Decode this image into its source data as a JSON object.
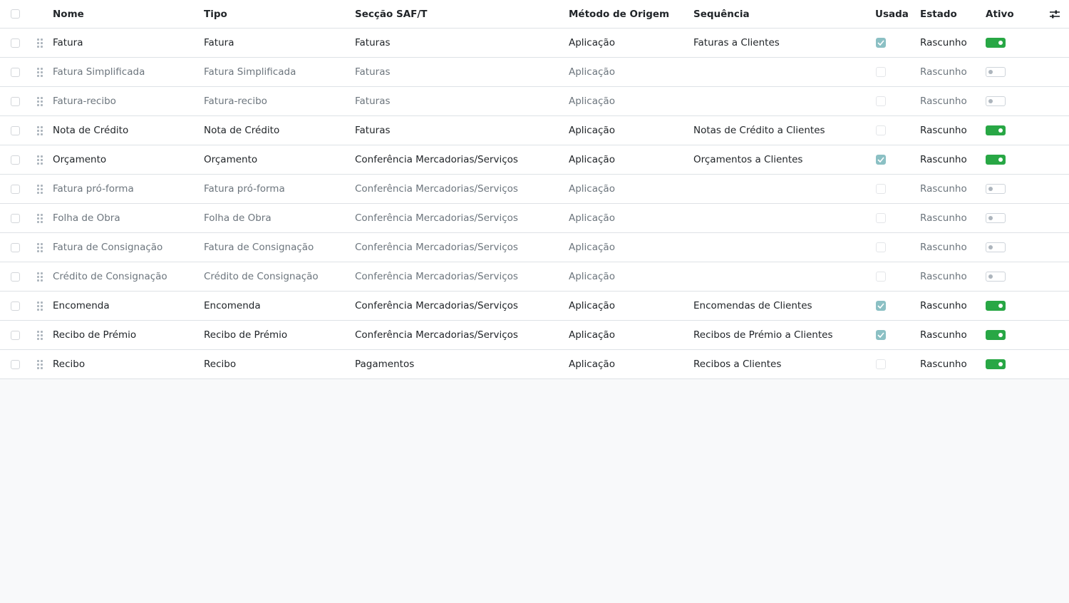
{
  "columns": {
    "nome": "Nome",
    "tipo": "Tipo",
    "saft": "Secção SAF/T",
    "metodo": "Método de Origem",
    "sequencia": "Sequência",
    "usada": "Usada",
    "estado": "Estado",
    "ativo": "Ativo"
  },
  "colors": {
    "toggle_on": "#28a745",
    "checked": "#8bc0c4"
  },
  "rows": [
    {
      "nome": "Fatura",
      "tipo": "Fatura",
      "saft": "Faturas",
      "metodo": "Aplicação",
      "sequencia": "Faturas a Clientes",
      "usada": true,
      "estado": "Rascunho",
      "ativo": true
    },
    {
      "nome": "Fatura Simplificada",
      "tipo": "Fatura Simplificada",
      "saft": "Faturas",
      "metodo": "Aplicação",
      "sequencia": "",
      "usada": false,
      "estado": "Rascunho",
      "ativo": false
    },
    {
      "nome": "Fatura-recibo",
      "tipo": "Fatura-recibo",
      "saft": "Faturas",
      "metodo": "Aplicação",
      "sequencia": "",
      "usada": false,
      "estado": "Rascunho",
      "ativo": false
    },
    {
      "nome": "Nota de Crédito",
      "tipo": "Nota de Crédito",
      "saft": "Faturas",
      "metodo": "Aplicação",
      "sequencia": "Notas de Crédito a Clientes",
      "usada": false,
      "estado": "Rascunho",
      "ativo": true
    },
    {
      "nome": "Orçamento",
      "tipo": "Orçamento",
      "saft": "Conferência Mercadorias/Serviços",
      "metodo": "Aplicação",
      "sequencia": "Orçamentos a Clientes",
      "usada": true,
      "estado": "Rascunho",
      "ativo": true
    },
    {
      "nome": "Fatura pró-forma",
      "tipo": "Fatura pró-forma",
      "saft": "Conferência Mercadorias/Serviços",
      "metodo": "Aplicação",
      "sequencia": "",
      "usada": false,
      "estado": "Rascunho",
      "ativo": false
    },
    {
      "nome": "Folha de Obra",
      "tipo": "Folha de Obra",
      "saft": "Conferência Mercadorias/Serviços",
      "metodo": "Aplicação",
      "sequencia": "",
      "usada": false,
      "estado": "Rascunho",
      "ativo": false
    },
    {
      "nome": "Fatura de Consignação",
      "tipo": "Fatura de Consignação",
      "saft": "Conferência Mercadorias/Serviços",
      "metodo": "Aplicação",
      "sequencia": "",
      "usada": false,
      "estado": "Rascunho",
      "ativo": false
    },
    {
      "nome": "Crédito de Consignação",
      "tipo": "Crédito de Consignação",
      "saft": "Conferência Mercadorias/Serviços",
      "metodo": "Aplicação",
      "sequencia": "",
      "usada": false,
      "estado": "Rascunho",
      "ativo": false
    },
    {
      "nome": "Encomenda",
      "tipo": "Encomenda",
      "saft": "Conferência Mercadorias/Serviços",
      "metodo": "Aplicação",
      "sequencia": "Encomendas de Clientes",
      "usada": true,
      "estado": "Rascunho",
      "ativo": true
    },
    {
      "nome": "Recibo de Prémio",
      "tipo": "Recibo de Prémio",
      "saft": "Conferência Mercadorias/Serviços",
      "metodo": "Aplicação",
      "sequencia": "Recibos de Prémio a Clientes",
      "usada": true,
      "estado": "Rascunho",
      "ativo": true
    },
    {
      "nome": "Recibo",
      "tipo": "Recibo",
      "saft": "Pagamentos",
      "metodo": "Aplicação",
      "sequencia": "Recibos a Clientes",
      "usada": false,
      "estado": "Rascunho",
      "ativo": true
    }
  ]
}
